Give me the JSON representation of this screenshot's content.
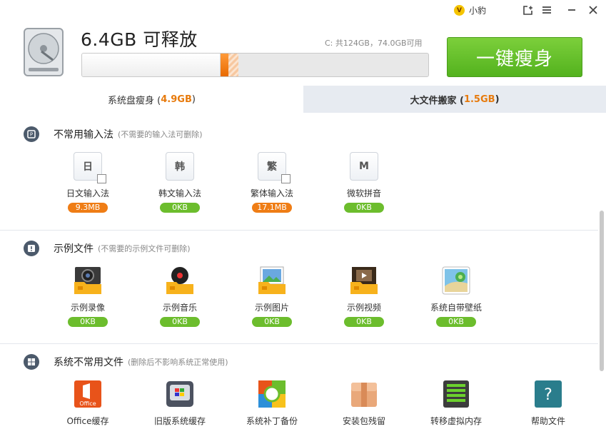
{
  "window": {
    "user_name": "小豹",
    "user_avatar_letter": "V",
    "buttons": [
      "share-icon",
      "menu-icon",
      "minimize-icon",
      "close-icon"
    ]
  },
  "header": {
    "headline": "6.4GB 可释放",
    "disk_info": "C: 共124GB，74.0GB可用",
    "progress": {
      "used_fraction": 0.4,
      "releasable_fraction": 0.052
    },
    "slim_button": "一键瘦身"
  },
  "tabs": [
    {
      "label": "系统盘瘦身 (",
      "size": "4.9GB",
      "suffix": ")",
      "active": true
    },
    {
      "label": "大文件搬家 (",
      "size": "1.5GB",
      "suffix": ")",
      "active": false
    }
  ],
  "sections": [
    {
      "title": "不常用输入法",
      "note": "(不需要的输入法可删除)",
      "icon": "keyboard-icon",
      "items": [
        {
          "glyph": "日",
          "label": "日文输入法",
          "size": "9.3MB",
          "highlight": true,
          "checkbox": true
        },
        {
          "glyph": "韩",
          "label": "韩文输入法",
          "size": "0KB",
          "highlight": false,
          "checkbox": false
        },
        {
          "glyph": "繁",
          "label": "繁体输入法",
          "size": "17.1MB",
          "highlight": true,
          "checkbox": true
        },
        {
          "glyph": "M",
          "label": "微软拼音",
          "size": "0KB",
          "highlight": false,
          "checkbox": false
        }
      ]
    },
    {
      "title": "示例文件",
      "note": "(不需要的示例文件可删除)",
      "icon": "exclamation-icon",
      "items": [
        {
          "label": "示例录像",
          "size": "0KB",
          "icon": "video-folder-icon"
        },
        {
          "label": "示例音乐",
          "size": "0KB",
          "icon": "music-folder-icon"
        },
        {
          "label": "示例图片",
          "size": "0KB",
          "icon": "picture-folder-icon"
        },
        {
          "label": "示例视频",
          "size": "0KB",
          "icon": "film-folder-icon"
        },
        {
          "label": "系统自带壁纸",
          "size": "0KB",
          "icon": "wallpaper-icon"
        }
      ]
    },
    {
      "title": "系统不常用文件",
      "note": "(删除后不影响系统正常使用)",
      "icon": "windows-icon",
      "items": [
        {
          "label": "Office缓存",
          "icon": "office-icon",
          "icon_text": "Office"
        },
        {
          "label": "旧版系统缓存",
          "icon": "old-system-icon"
        },
        {
          "label": "系统补丁备份",
          "icon": "patch-backup-icon"
        },
        {
          "label": "安装包残留",
          "icon": "installer-box-icon"
        },
        {
          "label": "转移虚拟内存",
          "icon": "virtual-memory-icon"
        },
        {
          "label": "帮助文件",
          "icon": "help-file-icon",
          "icon_text": "?"
        }
      ]
    }
  ]
}
